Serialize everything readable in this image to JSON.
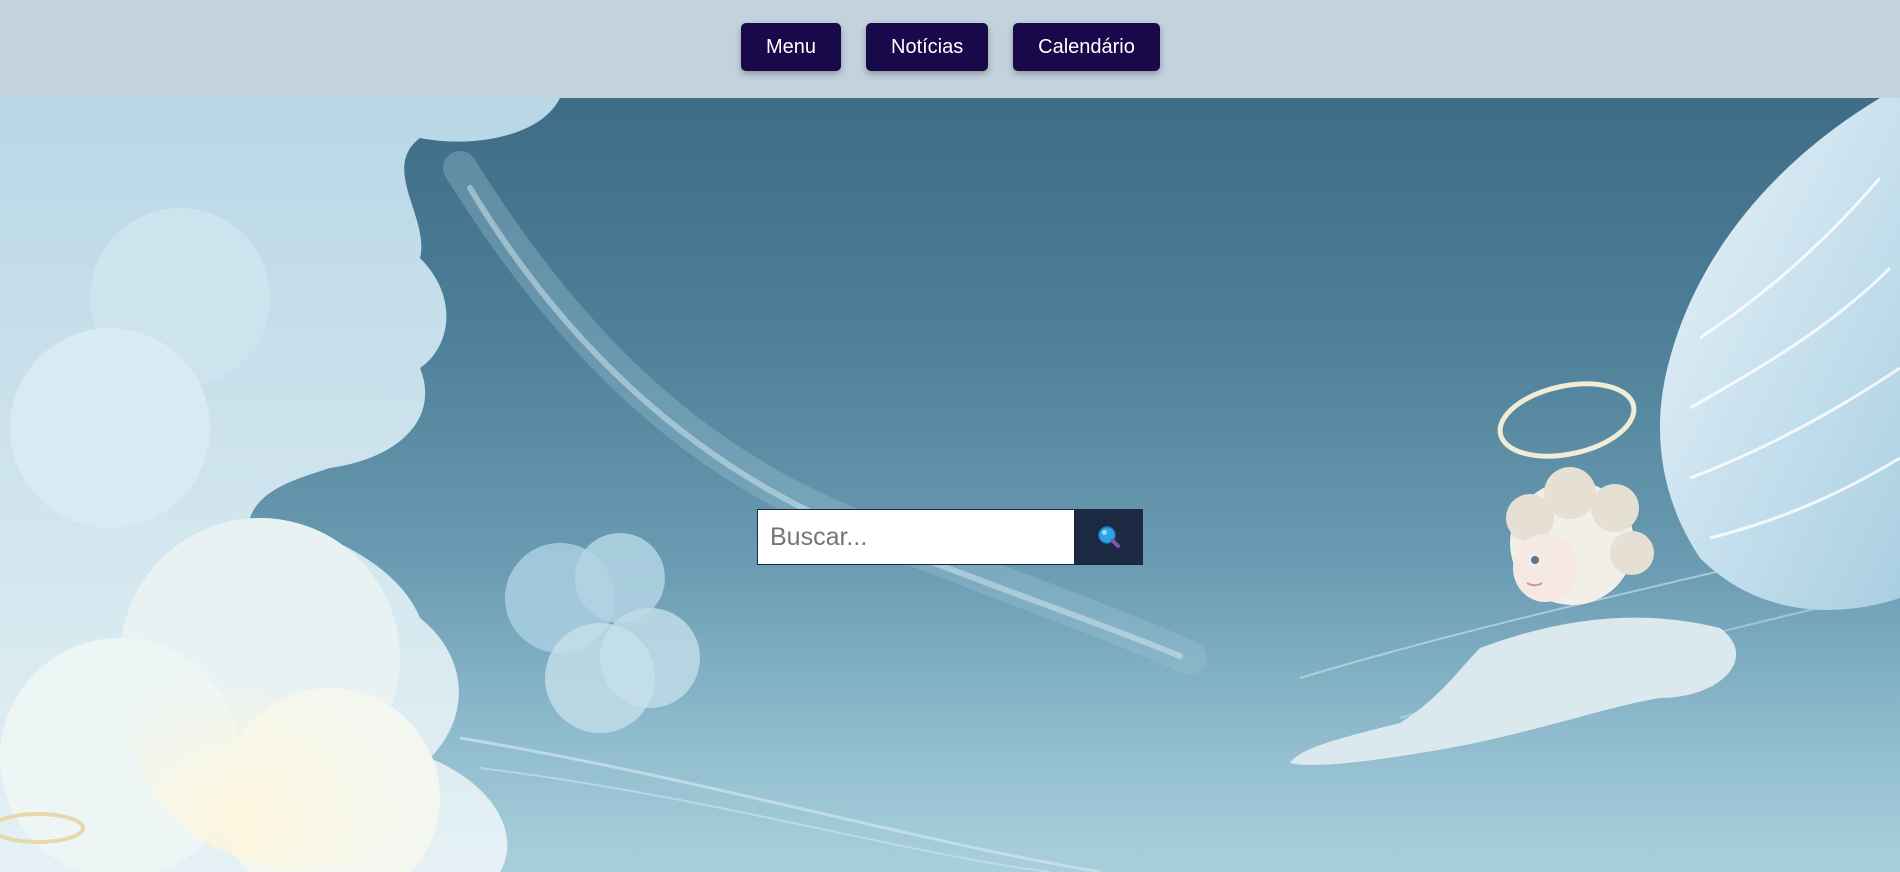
{
  "nav": {
    "menu_label": "Menu",
    "noticias_label": "Notícias",
    "calendario_label": "Calendário"
  },
  "search": {
    "placeholder": "Buscar...",
    "value": "",
    "icon": "magnifier-icon"
  },
  "colors": {
    "navbar_bg": "#c3d2dd",
    "nav_button_bg": "#17094a",
    "nav_button_text": "#ffffff",
    "search_button_bg": "#1b2943",
    "sky": "#4d7f98"
  }
}
